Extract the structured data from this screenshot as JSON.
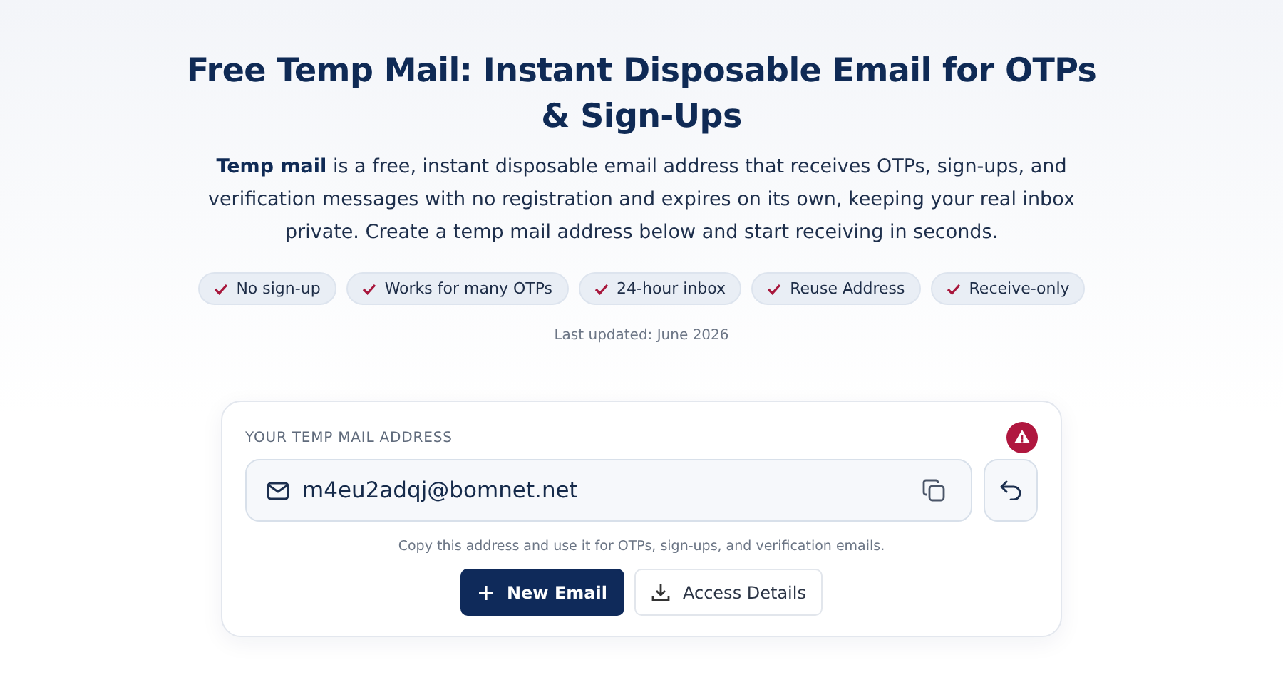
{
  "heading": "Free Temp Mail: Instant Disposable Email for OTPs & Sign-Ups",
  "intro": "**Temp mail** is a free, instant disposable email address that receives OTPs, sign-ups, and verification messages with no registration and expires on its own, keeping your real inbox private. Create a temp mail address below and start receiving in seconds.",
  "features": [
    "No sign-up",
    "Works for many OTPs",
    "24-hour inbox",
    "Reuse Address",
    "Receive-only"
  ],
  "last_updated": "Last updated: June 2026",
  "address_card": {
    "label": "YOUR TEMP MAIL ADDRESS",
    "address": "m4eu2adqj@bomnet.net",
    "hint": "Copy this address and use it for OTPs, sign-ups, and verification emails.",
    "buttons": [
      {
        "label": "New Email",
        "kind": "primary"
      },
      {
        "label": "Access Details",
        "kind": "secondary"
      }
    ]
  }
}
